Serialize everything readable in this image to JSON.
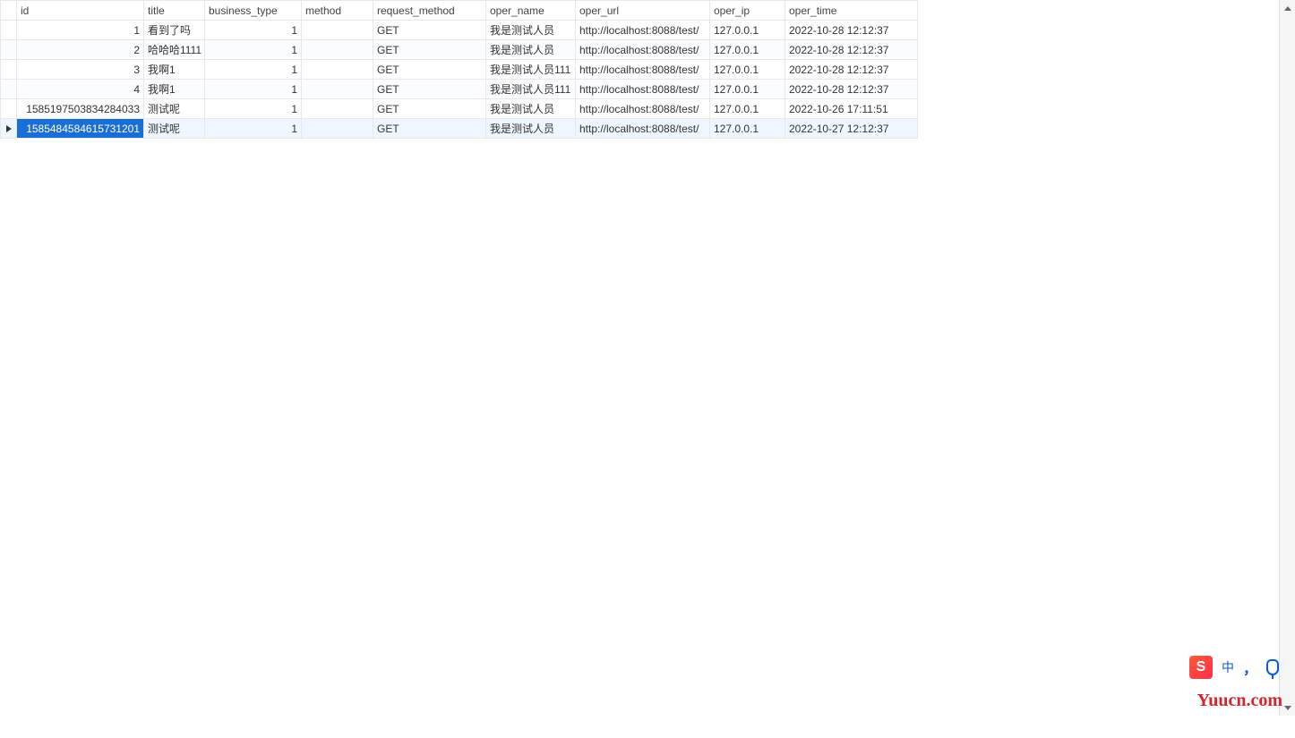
{
  "columns": [
    "id",
    "title",
    "business_type",
    "method",
    "request_method",
    "oper_name",
    "oper_url",
    "oper_ip",
    "oper_time"
  ],
  "rows": [
    {
      "id": "1",
      "title": "看到了吗",
      "business_type": "1",
      "method": "",
      "request_method": "GET",
      "oper_name": "我是测试人员",
      "oper_url": "http://localhost:8088/test/",
      "oper_ip": "127.0.0.1",
      "oper_time": "2022-10-28 12:12:37",
      "selected": false
    },
    {
      "id": "2",
      "title": "哈哈哈1111",
      "business_type": "1",
      "method": "",
      "request_method": "GET",
      "oper_name": "我是测试人员",
      "oper_url": "http://localhost:8088/test/",
      "oper_ip": "127.0.0.1",
      "oper_time": "2022-10-28 12:12:37",
      "selected": false
    },
    {
      "id": "3",
      "title": "我啊1",
      "business_type": "1",
      "method": "",
      "request_method": "GET",
      "oper_name": "我是测试人员111",
      "oper_url": "http://localhost:8088/test/",
      "oper_ip": "127.0.0.1",
      "oper_time": "2022-10-28 12:12:37",
      "selected": false
    },
    {
      "id": "4",
      "title": "我啊1",
      "business_type": "1",
      "method": "",
      "request_method": "GET",
      "oper_name": "我是测试人员111",
      "oper_url": "http://localhost:8088/test/",
      "oper_ip": "127.0.0.1",
      "oper_time": "2022-10-28 12:12:37",
      "selected": false
    },
    {
      "id": "1585197503834284033",
      "title": "测试呢",
      "business_type": "1",
      "method": "",
      "request_method": "GET",
      "oper_name": "我是测试人员",
      "oper_url": "http://localhost:8088/test/",
      "oper_ip": "127.0.0.1",
      "oper_time": "2022-10-26 17:11:51",
      "selected": false
    },
    {
      "id": "1585484584615731201",
      "title": "测试呢",
      "business_type": "1",
      "method": "",
      "request_method": "GET",
      "oper_name": "我是测试人员",
      "oper_url": "http://localhost:8088/test/",
      "oper_ip": "127.0.0.1",
      "oper_time": "2022-10-27 12:12:37",
      "selected": true
    }
  ],
  "ime": {
    "logo": "S",
    "lang": "中",
    "comma": "，"
  },
  "watermark": "Yuucn.com"
}
